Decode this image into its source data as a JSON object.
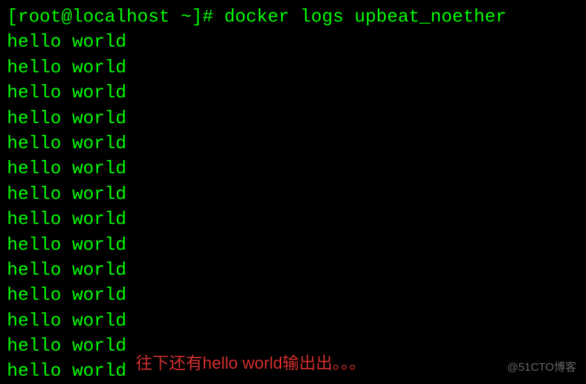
{
  "prompt": "[root@localhost ~]# ",
  "command": "docker logs upbeat_noether",
  "output_lines": [
    "hello world",
    "hello world",
    "hello world",
    "hello world",
    "hello world",
    "hello world",
    "hello world",
    "hello world",
    "hello world",
    "hello world",
    "hello world",
    "hello world",
    "hello world",
    "hello world"
  ],
  "annotation": "往下还有hello world输出出。。。",
  "watermark": "@51CTO博客"
}
